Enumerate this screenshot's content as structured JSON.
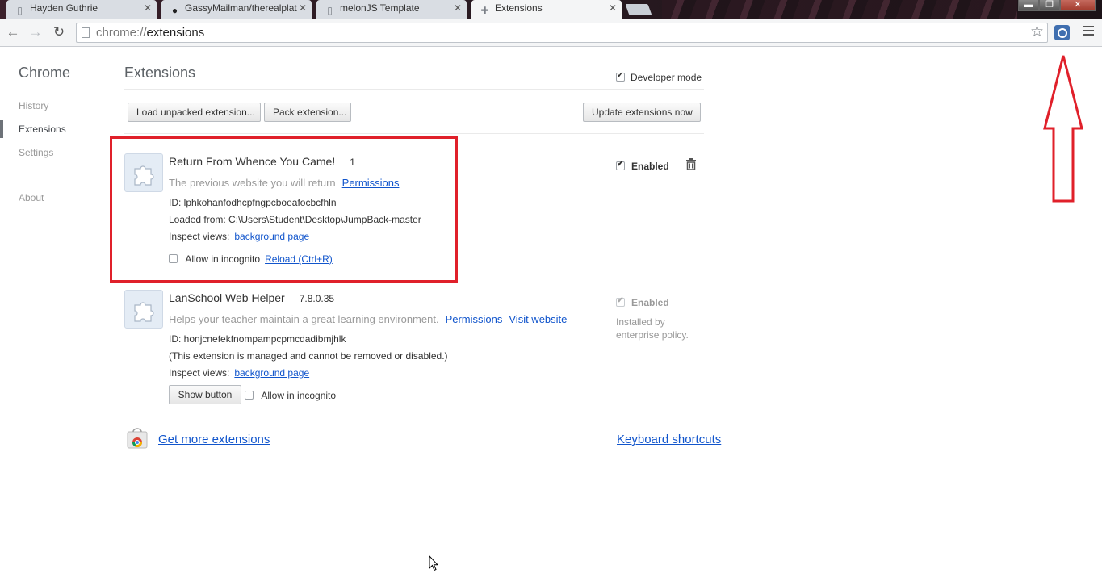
{
  "tabs": [
    {
      "title": "Hayden Guthrie",
      "icon": "page-icon"
    },
    {
      "title": "GassyMailman/therealplat",
      "icon": "github-icon"
    },
    {
      "title": "melonJS Template",
      "icon": "page-icon"
    },
    {
      "title": "Extensions",
      "icon": "puzzle-icon"
    }
  ],
  "window_controls": {
    "minimize": "▬",
    "maximize": "❐",
    "close": "✕"
  },
  "address": {
    "scheme": "chrome://",
    "path": "extensions"
  },
  "sidebar": {
    "title": "Chrome",
    "items": [
      "History",
      "Extensions",
      "Settings",
      "About"
    ],
    "selected": "Extensions"
  },
  "main": {
    "title": "Extensions",
    "developer_mode": "Developer mode",
    "buttons": {
      "load_unpacked": "Load unpacked extension...",
      "pack": "Pack extension...",
      "update": "Update extensions now"
    }
  },
  "extensions": [
    {
      "name": "Return From Whence You Came!",
      "version": "1",
      "description": "The previous website you will return",
      "permissions_link": "Permissions",
      "id_line": "ID: lphkohanfodhcpfngpcboeafocbcfhln",
      "loaded_from": "Loaded from: C:\\Users\\Student\\Desktop\\JumpBack-master",
      "inspect_label": "Inspect views:",
      "inspect_link": "background page",
      "incognito_label": "Allow in incognito",
      "reload_link": "Reload (Ctrl+R)",
      "enabled_label": "Enabled"
    },
    {
      "name": "LanSchool Web Helper",
      "version": "7.8.0.35",
      "description": "Helps your teacher maintain a great learning environment.",
      "permissions_link": "Permissions",
      "website_link": "Visit website",
      "id_line": "ID: honjcnefekfnompampcpmcdadibmjhlk",
      "managed_note": "(This extension is managed and cannot be removed or disabled.)",
      "inspect_label": "Inspect views:",
      "inspect_link": "background page",
      "show_button": "Show button",
      "incognito_label": "Allow in incognito",
      "enabled_label": "Enabled",
      "policy_note": "Installed by enterprise policy."
    }
  ],
  "footer": {
    "get_more": "Get more extensions",
    "shortcuts": "Keyboard shortcuts"
  },
  "colors": {
    "highlight": "#e0202a",
    "link": "#1155cc"
  }
}
